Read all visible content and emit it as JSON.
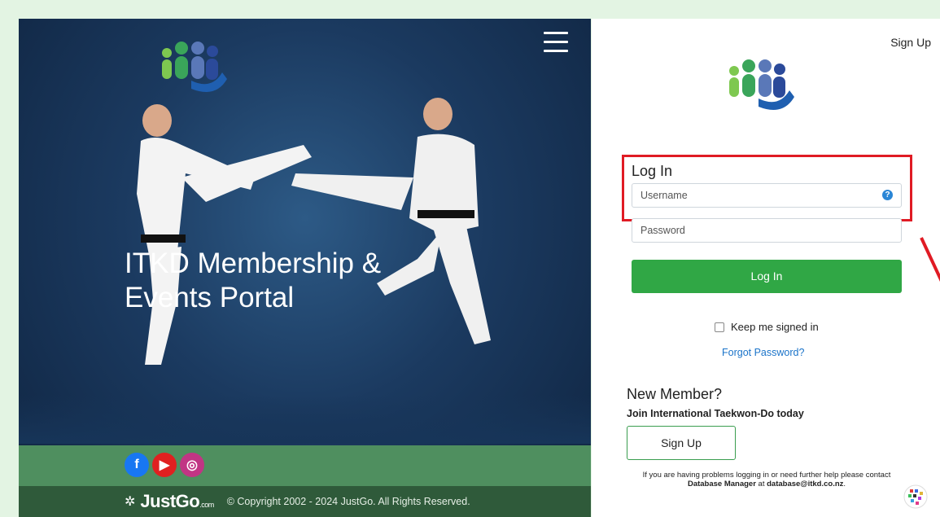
{
  "hero": {
    "title": "ITKD Membership & Events Portal",
    "menu_icon": "hamburger-icon",
    "socials": [
      {
        "name": "facebook-icon",
        "glyph": "f"
      },
      {
        "name": "youtube-icon",
        "glyph": "▶"
      },
      {
        "name": "instagram-icon",
        "glyph": "◎"
      }
    ],
    "footer": {
      "brand": "JustGo",
      "brand_suffix": ".com",
      "copyright": "© Copyright 2002 - 2024 JustGo. All Rights Reserved."
    }
  },
  "panel": {
    "signup_link": "Sign Up",
    "login": {
      "title": "Log In",
      "username_placeholder": "Username",
      "password_placeholder": "Password",
      "submit_label": "Log In",
      "keep_signed_in": "Keep me signed in",
      "forgot_password": "Forgot Password?"
    },
    "new_member": {
      "title": "New Member?",
      "subtitle": "Join International Taekwon-Do today",
      "signup_label": "Sign Up"
    },
    "help": {
      "text_before": "If you are having problems logging in or need further help please contact",
      "contact_name": "Database Manager",
      "text_mid": "at",
      "email": "database@itkd.co.nz",
      "text_after": "."
    }
  },
  "colors": {
    "primary_green": "#30a745",
    "link_blue": "#1a73c9",
    "highlight_red": "#e01b24"
  }
}
